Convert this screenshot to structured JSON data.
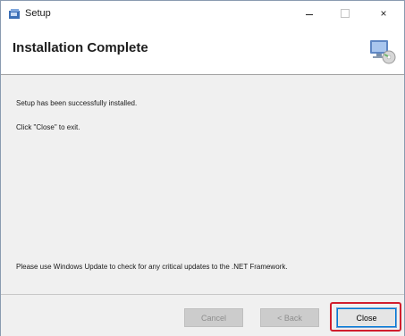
{
  "window": {
    "title": "Setup",
    "caption_buttons": {
      "minimize": "minimize-icon",
      "maximize": "maximize-icon",
      "close": "×"
    }
  },
  "banner": {
    "title": "Installation Complete",
    "icon": "computer-cd-icon"
  },
  "messages": {
    "success": "Setup has been successfully installed.",
    "instruction": "Click \"Close\" to exit.",
    "update_notice": "Please use Windows Update to check for any critical updates to the .NET Framework."
  },
  "buttons": {
    "cancel": "Cancel",
    "back": "< Back",
    "close": "Close"
  },
  "colors": {
    "highlight": "#d11e2e",
    "focus": "#0078d7"
  }
}
